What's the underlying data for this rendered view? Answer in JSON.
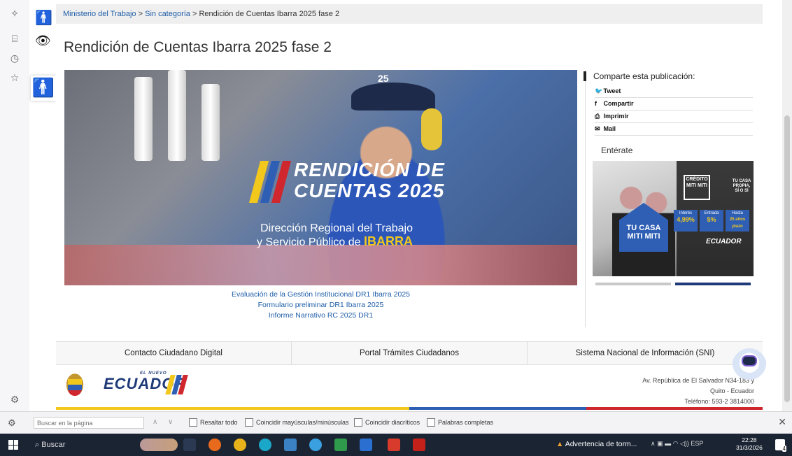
{
  "browser_sidebar": {
    "icons": [
      "sparkle-icon",
      "translate-icon",
      "history-icon",
      "favorites-star-icon"
    ],
    "settings_icon": "gear-icon"
  },
  "accessibility": {
    "buttons": [
      "accessibility-person-icon",
      "eye-icon",
      "accessibility-person-large-icon"
    ]
  },
  "breadcrumb": {
    "home": "Ministerio del Trabajo",
    "sep1": " > ",
    "category": "Sin categoría",
    "sep2": " > ",
    "current": "Rendición de Cuentas Ibarra 2025 fase 2"
  },
  "page_title": "Rendición de Cuentas Ibarra 2025 fase 2",
  "hero": {
    "title_line1": "RENDICIÓN DE",
    "title_line2": "CUENTAS",
    "title_year": "2025",
    "subtitle_line1": "Dirección Regional del Trabajo",
    "subtitle_line2": "y Servicio Público de",
    "subtitle_city": "IBARRA",
    "cap_text": "25"
  },
  "document_links": [
    "Evaluación de la Gestión Institucional DR1 Ibarra 2025",
    "Formulario preliminar DR1 Ibarra 2025",
    "Informe Narrativo RC 2025 DR1"
  ],
  "share": {
    "title": "Comparte esta publicación:",
    "items": [
      {
        "icon": "twitter-icon",
        "glyph": "🐦",
        "label": "Tweet"
      },
      {
        "icon": "facebook-icon",
        "glyph": "f",
        "label": "Compartir"
      },
      {
        "icon": "print-icon",
        "glyph": "⎙",
        "label": "Imprimir"
      },
      {
        "icon": "mail-icon",
        "glyph": "✉",
        "label": "Mail"
      }
    ]
  },
  "enterate": {
    "title": "Entérate",
    "ad": {
      "house_text": "TU CASA MITI MITI",
      "badge": "CRÉDITO MITI MITI",
      "tagline": "TU CASA PROPIA, SÍ O SÍ",
      "pills": [
        {
          "label": "Interés",
          "value": "4,99%"
        },
        {
          "label": "Entrada",
          "value": "5%"
        },
        {
          "label": "Hasta",
          "value": "25 años plazo"
        }
      ],
      "brand": "ECUADOR"
    },
    "slider_colors": [
      "#c8c8c8",
      "#1e3a78"
    ]
  },
  "footer_links": [
    "Contacto Ciudadano Digital",
    "Portal Trámites Ciudadanos",
    "Sistema Nacional de Información (SNI)"
  ],
  "footer": {
    "logo_small": "EL NUEVO",
    "logo_text": "ECUADOR",
    "address": "Av. República de El Salvador N34-183 y",
    "city": "Quito - Ecuador",
    "phone": "Teléfono: 593-2 3814000"
  },
  "colors": {
    "flag_yellow": "#f2c81d",
    "flag_blue": "#2f5fb5",
    "flag_red": "#d0262e",
    "link": "#1f5ea8"
  },
  "find_bar": {
    "placeholder": "Buscar en la página",
    "options": [
      "Resaltar todo",
      "Coincidir mayúsculas/minúsculas",
      "Coincidir diacríticos",
      "Palabras completas"
    ]
  },
  "taskbar": {
    "search": "Buscar",
    "warning": "Advertencia de torm...",
    "lang": "ESP",
    "time": "22:28",
    "date": "31/3/2026",
    "notif_count": "4"
  }
}
